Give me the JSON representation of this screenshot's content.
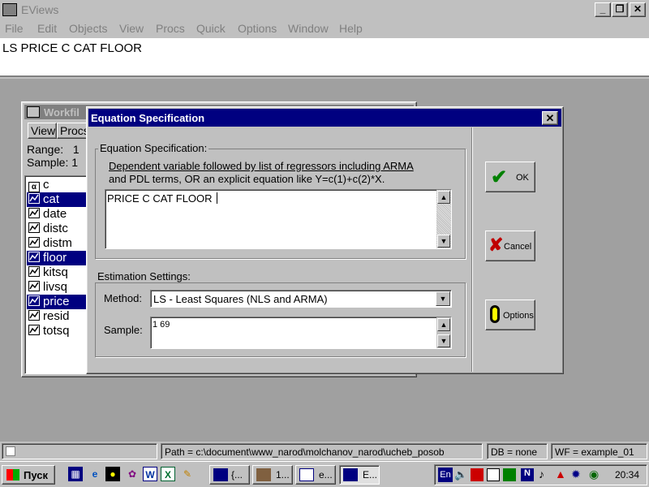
{
  "app": {
    "title": "EViews",
    "controls": {
      "minimize": "_",
      "restore": "❐",
      "close": "✕"
    }
  },
  "menu": [
    "File",
    "Edit",
    "Objects",
    "View",
    "Procs",
    "Quick",
    "Options",
    "Window",
    "Help"
  ],
  "command": "LS PRICE  C CAT FLOOR",
  "workfile": {
    "title": "Workfil",
    "toolbar": [
      "View",
      "Procs"
    ],
    "range_label": "Range:",
    "range_value": "1",
    "sample_label": "Sample:",
    "sample_value": "1",
    "objects": [
      {
        "name": "c",
        "icon": "alpha-icon",
        "selected": false
      },
      {
        "name": "cat",
        "icon": "series-icon",
        "selected": true
      },
      {
        "name": "date",
        "icon": "series-icon",
        "selected": false
      },
      {
        "name": "distc",
        "icon": "series-icon",
        "selected": false
      },
      {
        "name": "distm",
        "icon": "series-icon",
        "selected": false
      },
      {
        "name": "floor",
        "icon": "series-icon",
        "selected": true
      },
      {
        "name": "kitsq",
        "icon": "series-icon",
        "selected": false
      },
      {
        "name": "livsq",
        "icon": "series-icon",
        "selected": false
      },
      {
        "name": "price",
        "icon": "series-icon",
        "selected": true
      },
      {
        "name": "resid",
        "icon": "series-icon",
        "selected": false
      },
      {
        "name": "totsq",
        "icon": "series-icon",
        "selected": false
      }
    ]
  },
  "dialog": {
    "title": "Equation Specification",
    "close": "✕",
    "spec_group": "Equation Specification:",
    "spec_help_1": "Dependent variable followed by list of regressors including ARMA",
    "spec_help_2": "and PDL terms, OR an explicit equation like Y=c(1)+c(2)*X.",
    "spec_value": "PRICE  C CAT FLOOR",
    "settings_group": "Estimation Settings:",
    "method_label": "Method:",
    "method_value": "LS  -  Least Squares (NLS and ARMA)",
    "sample_label": "Sample:",
    "sample_value": "1 69",
    "ok": "OK",
    "cancel": "Cancel",
    "options": "Options"
  },
  "status": {
    "path": "Path = c:\\document\\www_narod\\molchanov_narod\\ucheb_posob",
    "db": "DB = none",
    "wf": "WF = example_01"
  },
  "taskbar": {
    "start": "Пуск",
    "tasks": [
      "{...",
      "1...",
      "e...",
      "E..."
    ],
    "lang": "En",
    "time": "20:34"
  },
  "colors": {
    "titlebar_active": "#000080",
    "selection": "#000080",
    "face": "#c0c0c0",
    "desktop": "#a0a0a0"
  }
}
